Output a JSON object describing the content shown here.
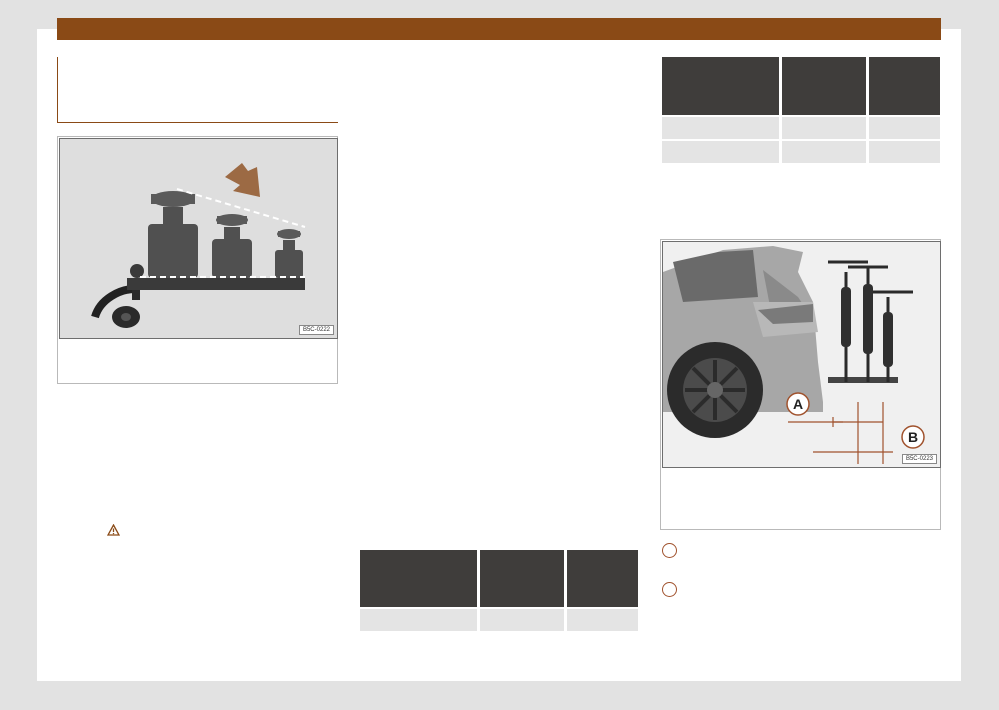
{
  "figure1": {
    "code": "B5C-0222",
    "accent_color": "#8a4a16"
  },
  "figure2": {
    "code": "B5C-0223",
    "label_a": "A",
    "label_b": "B"
  },
  "colors": {
    "top_bar": "#8a4a16",
    "table_header": "#3f3d3b",
    "table_row": "#e4e4e4"
  }
}
